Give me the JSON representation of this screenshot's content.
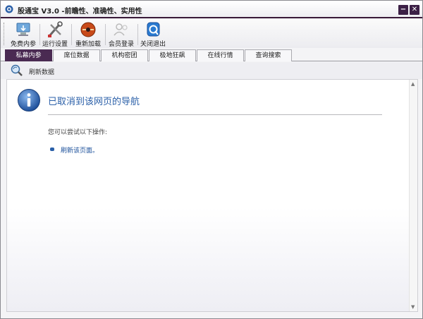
{
  "window": {
    "title": "股通宝 V3.0  -前瞻性、准确性、实用性",
    "minimize_label": "−",
    "close_label": "✕"
  },
  "toolbar": {
    "items": [
      {
        "label": "免费内参",
        "icon": "computer-download-icon"
      },
      {
        "label": "运行设置",
        "icon": "tools-icon"
      },
      {
        "label": "重新加载",
        "icon": "reload-disc-icon"
      },
      {
        "label": "会员登录",
        "icon": "user-login-icon"
      },
      {
        "label": "关闭退出",
        "icon": "exit-icon"
      }
    ]
  },
  "tabs": [
    {
      "label": "私幕内参",
      "active": true
    },
    {
      "label": "席位数据",
      "active": false
    },
    {
      "label": "机构密团",
      "active": false
    },
    {
      "label": "极地狂飙",
      "active": false
    },
    {
      "label": "在线行情",
      "active": false
    },
    {
      "label": "查询搜索",
      "active": false
    }
  ],
  "refresh": {
    "label": "刷新数据",
    "icon": "magnifier-refresh-icon"
  },
  "content": {
    "title": "已取消到该网页的导航",
    "subtitle": "您可以尝试以下操作:",
    "link": "刷新该页面。",
    "icon": "info-icon"
  },
  "colors": {
    "accent": "#4a2a52",
    "link": "#1a4f9a",
    "title_blue": "#2a5fa8"
  }
}
